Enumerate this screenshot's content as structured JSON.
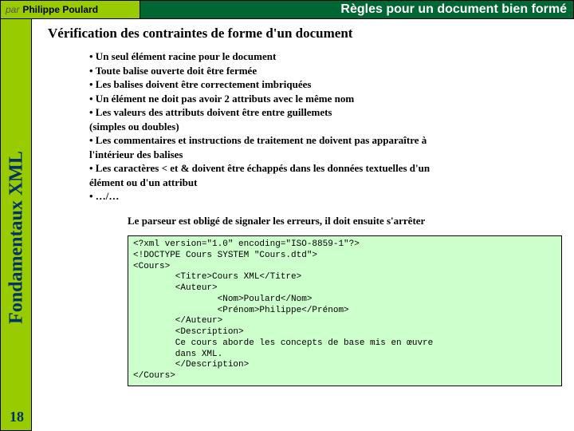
{
  "header": {
    "par_label": "par",
    "author": "Philippe Poulard",
    "title": "Règles pour un document bien formé"
  },
  "sidebar": {
    "vertical_label": "Fondamentaux XML",
    "page_number": "18"
  },
  "content": {
    "subtitle": "Vérification des contraintes de forme d'un document",
    "bullets": [
      "• Un seul élément racine pour le document",
      "• Toute balise ouverte doit être fermée",
      "• Les balises doivent être correctement imbriquées",
      "• Un élément ne doit pas avoir 2 attributs avec le même nom",
      "• Les valeurs des attributs doivent être entre guillemets",
      "(simples ou doubles)",
      "• Les commentaires et instructions de traitement ne doivent pas apparaître à",
      "l'intérieur des balises",
      "• Les caractères < et & doivent être échappés dans les données textuelles d'un",
      "élément ou d'un attribut",
      "• …/…"
    ],
    "parser_note": "Le parseur est obligé de signaler les erreurs, il doit ensuite s'arrêter",
    "code": "<?xml version=\"1.0\" encoding=\"ISO-8859-1\"?>\n<!DOCTYPE Cours SYSTEM \"Cours.dtd\">\n<Cours>\n        <Titre>Cours XML</Titre>\n        <Auteur>\n                <Nom>Poulard</Nom>\n                <Prénom>Philippe</Prénom>\n        </Auteur>\n        <Description>\n        Ce cours aborde les concepts de base mis en œuvre\n        dans XML.\n        </Description>\n</Cours>"
  }
}
